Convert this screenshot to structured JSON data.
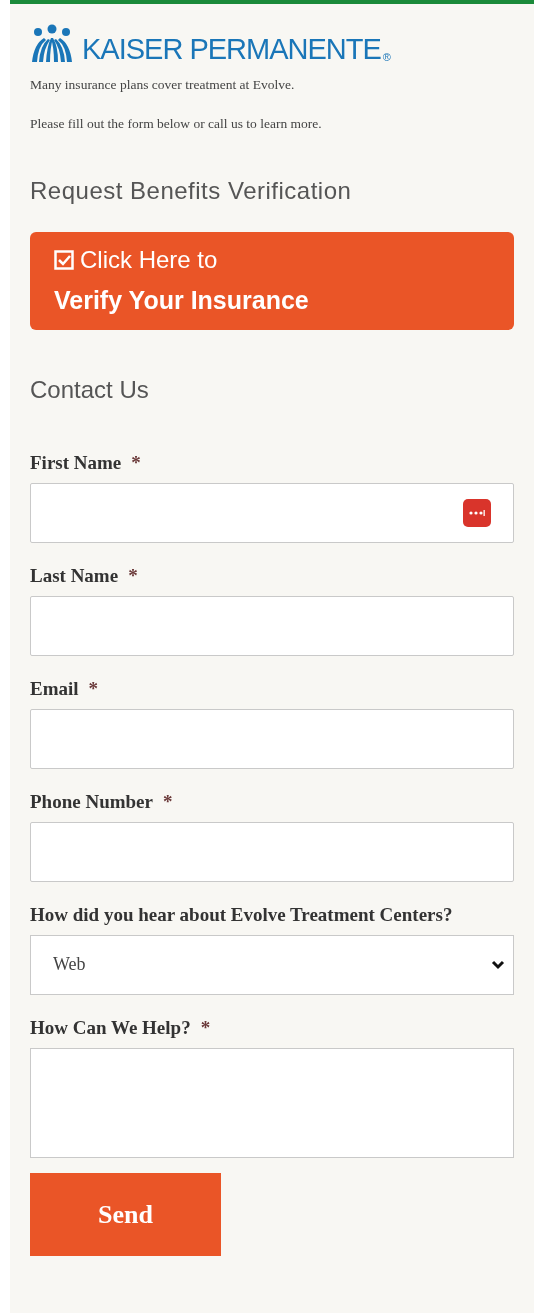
{
  "logo": {
    "wordmark": "KAISER PERMANENTE",
    "mark": "®"
  },
  "intro": [
    "Many insurance plans cover treatment at Evolve.",
    "Please fill out the form below or call us to learn more."
  ],
  "benefits_heading": "Request Benefits Verification",
  "verify_button": {
    "line_1": "Click Here to",
    "line_2": "Verify Your Insurance"
  },
  "contact_heading": "Contact Us",
  "fields": [
    {
      "kind": "text",
      "label": "First Name",
      "required": true,
      "autofill_icon": true
    },
    {
      "kind": "text",
      "label": "Last Name",
      "required": true,
      "autofill_icon": false
    },
    {
      "kind": "text",
      "label": "Email",
      "required": true,
      "autofill_icon": false
    },
    {
      "kind": "text",
      "label": "Phone Number",
      "required": true,
      "autofill_icon": false
    },
    {
      "kind": "select",
      "label": "How did you hear about Evolve Treatment Centers?",
      "required": false,
      "value": "Web"
    },
    {
      "kind": "textarea",
      "label": "How Can We Help?",
      "required": true
    }
  ],
  "required_mark": "*",
  "send_button": "Send"
}
